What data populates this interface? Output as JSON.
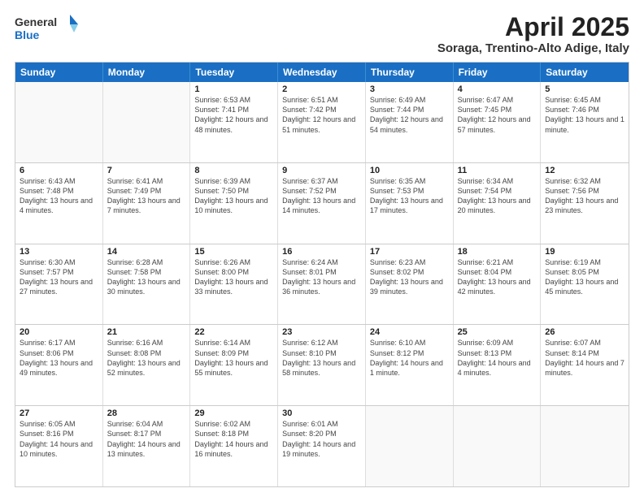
{
  "logo": {
    "general": "General",
    "blue": "Blue"
  },
  "title": "April 2025",
  "location": "Soraga, Trentino-Alto Adige, Italy",
  "days": [
    "Sunday",
    "Monday",
    "Tuesday",
    "Wednesday",
    "Thursday",
    "Friday",
    "Saturday"
  ],
  "weeks": [
    [
      {
        "day": "",
        "info": ""
      },
      {
        "day": "",
        "info": ""
      },
      {
        "day": "1",
        "info": "Sunrise: 6:53 AM\nSunset: 7:41 PM\nDaylight: 12 hours and 48 minutes."
      },
      {
        "day": "2",
        "info": "Sunrise: 6:51 AM\nSunset: 7:42 PM\nDaylight: 12 hours and 51 minutes."
      },
      {
        "day": "3",
        "info": "Sunrise: 6:49 AM\nSunset: 7:44 PM\nDaylight: 12 hours and 54 minutes."
      },
      {
        "day": "4",
        "info": "Sunrise: 6:47 AM\nSunset: 7:45 PM\nDaylight: 12 hours and 57 minutes."
      },
      {
        "day": "5",
        "info": "Sunrise: 6:45 AM\nSunset: 7:46 PM\nDaylight: 13 hours and 1 minute."
      }
    ],
    [
      {
        "day": "6",
        "info": "Sunrise: 6:43 AM\nSunset: 7:48 PM\nDaylight: 13 hours and 4 minutes."
      },
      {
        "day": "7",
        "info": "Sunrise: 6:41 AM\nSunset: 7:49 PM\nDaylight: 13 hours and 7 minutes."
      },
      {
        "day": "8",
        "info": "Sunrise: 6:39 AM\nSunset: 7:50 PM\nDaylight: 13 hours and 10 minutes."
      },
      {
        "day": "9",
        "info": "Sunrise: 6:37 AM\nSunset: 7:52 PM\nDaylight: 13 hours and 14 minutes."
      },
      {
        "day": "10",
        "info": "Sunrise: 6:35 AM\nSunset: 7:53 PM\nDaylight: 13 hours and 17 minutes."
      },
      {
        "day": "11",
        "info": "Sunrise: 6:34 AM\nSunset: 7:54 PM\nDaylight: 13 hours and 20 minutes."
      },
      {
        "day": "12",
        "info": "Sunrise: 6:32 AM\nSunset: 7:56 PM\nDaylight: 13 hours and 23 minutes."
      }
    ],
    [
      {
        "day": "13",
        "info": "Sunrise: 6:30 AM\nSunset: 7:57 PM\nDaylight: 13 hours and 27 minutes."
      },
      {
        "day": "14",
        "info": "Sunrise: 6:28 AM\nSunset: 7:58 PM\nDaylight: 13 hours and 30 minutes."
      },
      {
        "day": "15",
        "info": "Sunrise: 6:26 AM\nSunset: 8:00 PM\nDaylight: 13 hours and 33 minutes."
      },
      {
        "day": "16",
        "info": "Sunrise: 6:24 AM\nSunset: 8:01 PM\nDaylight: 13 hours and 36 minutes."
      },
      {
        "day": "17",
        "info": "Sunrise: 6:23 AM\nSunset: 8:02 PM\nDaylight: 13 hours and 39 minutes."
      },
      {
        "day": "18",
        "info": "Sunrise: 6:21 AM\nSunset: 8:04 PM\nDaylight: 13 hours and 42 minutes."
      },
      {
        "day": "19",
        "info": "Sunrise: 6:19 AM\nSunset: 8:05 PM\nDaylight: 13 hours and 45 minutes."
      }
    ],
    [
      {
        "day": "20",
        "info": "Sunrise: 6:17 AM\nSunset: 8:06 PM\nDaylight: 13 hours and 49 minutes."
      },
      {
        "day": "21",
        "info": "Sunrise: 6:16 AM\nSunset: 8:08 PM\nDaylight: 13 hours and 52 minutes."
      },
      {
        "day": "22",
        "info": "Sunrise: 6:14 AM\nSunset: 8:09 PM\nDaylight: 13 hours and 55 minutes."
      },
      {
        "day": "23",
        "info": "Sunrise: 6:12 AM\nSunset: 8:10 PM\nDaylight: 13 hours and 58 minutes."
      },
      {
        "day": "24",
        "info": "Sunrise: 6:10 AM\nSunset: 8:12 PM\nDaylight: 14 hours and 1 minute."
      },
      {
        "day": "25",
        "info": "Sunrise: 6:09 AM\nSunset: 8:13 PM\nDaylight: 14 hours and 4 minutes."
      },
      {
        "day": "26",
        "info": "Sunrise: 6:07 AM\nSunset: 8:14 PM\nDaylight: 14 hours and 7 minutes."
      }
    ],
    [
      {
        "day": "27",
        "info": "Sunrise: 6:05 AM\nSunset: 8:16 PM\nDaylight: 14 hours and 10 minutes."
      },
      {
        "day": "28",
        "info": "Sunrise: 6:04 AM\nSunset: 8:17 PM\nDaylight: 14 hours and 13 minutes."
      },
      {
        "day": "29",
        "info": "Sunrise: 6:02 AM\nSunset: 8:18 PM\nDaylight: 14 hours and 16 minutes."
      },
      {
        "day": "30",
        "info": "Sunrise: 6:01 AM\nSunset: 8:20 PM\nDaylight: 14 hours and 19 minutes."
      },
      {
        "day": "",
        "info": ""
      },
      {
        "day": "",
        "info": ""
      },
      {
        "day": "",
        "info": ""
      }
    ]
  ]
}
